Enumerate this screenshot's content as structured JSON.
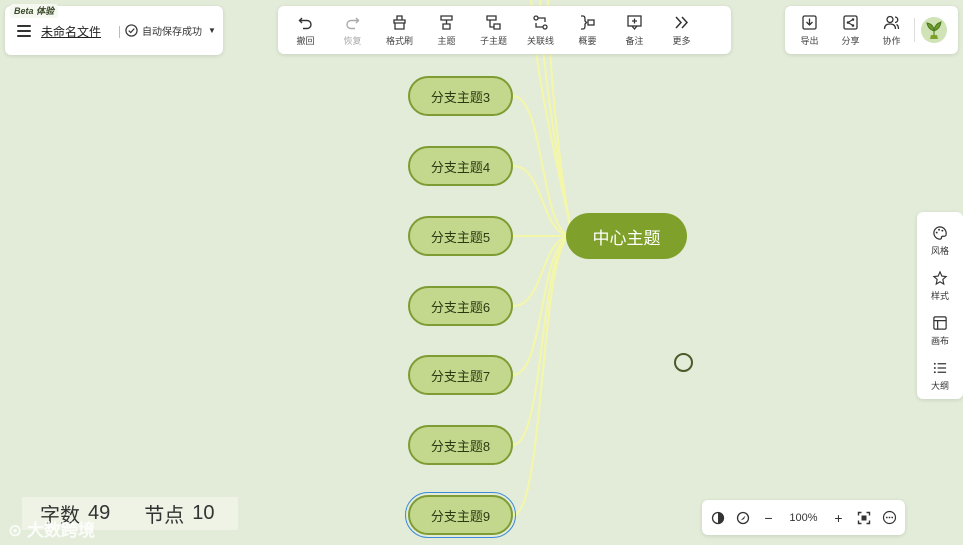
{
  "file": {
    "badge": "Beta 体验",
    "name": "未命名文件",
    "save_status": "自动保存成功"
  },
  "toolbar": [
    {
      "label": "撤回",
      "icon": "undo-icon"
    },
    {
      "label": "恢复",
      "icon": "redo-icon",
      "disabled": true
    },
    {
      "label": "格式刷",
      "icon": "format-brush-icon"
    },
    {
      "label": "主题",
      "icon": "topic-icon"
    },
    {
      "label": "子主题",
      "icon": "subtopic-icon"
    },
    {
      "label": "关联线",
      "icon": "relation-line-icon"
    },
    {
      "label": "概要",
      "icon": "summary-icon"
    },
    {
      "label": "备注",
      "icon": "note-icon"
    },
    {
      "label": "更多",
      "icon": "more-icon"
    }
  ],
  "right_tools": [
    {
      "label": "导出",
      "icon": "export-icon"
    },
    {
      "label": "分享",
      "icon": "share-icon"
    },
    {
      "label": "协作",
      "icon": "collaborate-icon"
    }
  ],
  "side_panel": [
    {
      "label": "风格",
      "icon": "palette-icon"
    },
    {
      "label": "样式",
      "icon": "style-icon"
    },
    {
      "label": "画布",
      "icon": "canvas-icon"
    },
    {
      "label": "大纲",
      "icon": "outline-icon"
    }
  ],
  "mindmap": {
    "center": "中心主题",
    "branches": [
      {
        "label": "分支主题3"
      },
      {
        "label": "分支主题4"
      },
      {
        "label": "分支主题5"
      },
      {
        "label": "分支主题6"
      },
      {
        "label": "分支主题7"
      },
      {
        "label": "分支主题8"
      },
      {
        "label": "分支主题9",
        "selected": true
      }
    ]
  },
  "stats": {
    "words_label": "字数",
    "words": "49",
    "nodes_label": "节点",
    "nodes": "10"
  },
  "watermark": "大数跨境",
  "zoom": {
    "level": "100%"
  },
  "colors": {
    "background": "#e3ecd9",
    "branch_fill": "#c3d88d",
    "branch_border": "#7e9c33",
    "center_fill": "#7fa02a",
    "connector": "#f5f7a8",
    "selection": "#3d8bd6"
  }
}
